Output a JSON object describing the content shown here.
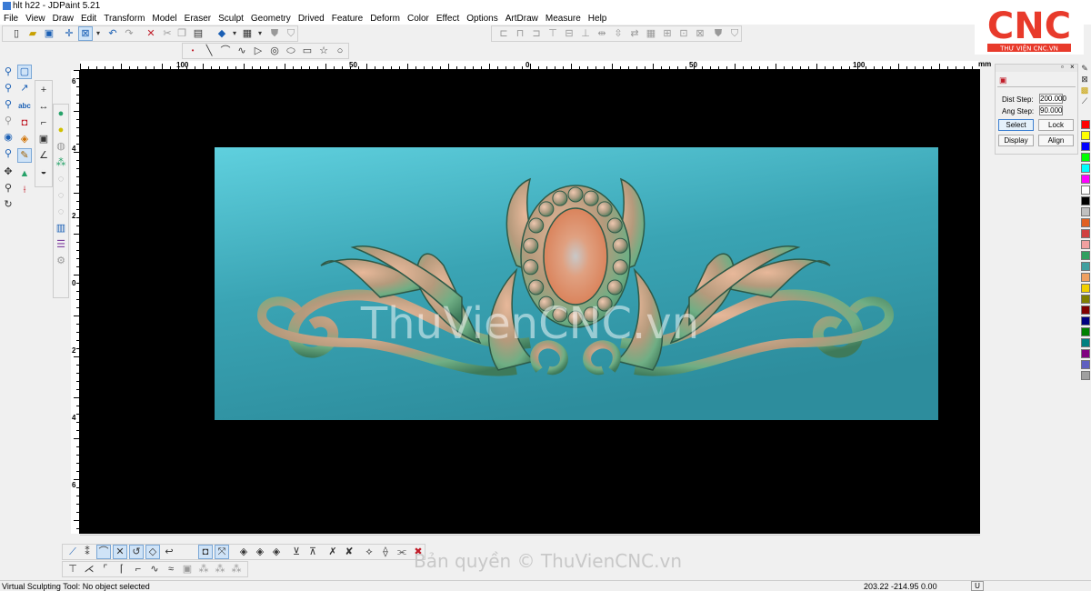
{
  "window": {
    "title": "hlt h22 - JDPaint 5.21"
  },
  "menu": [
    "File",
    "View",
    "Draw",
    "Edit",
    "Transform",
    "Model",
    "Eraser",
    "Sculpt",
    "Geometry",
    "Drived",
    "Feature",
    "Deform",
    "Color",
    "Effect",
    "Options",
    "ArtDraw",
    "Measure",
    "Help"
  ],
  "ruler": {
    "top_labels": [
      {
        "text": "100",
        "at": "left"
      },
      {
        "text": "50",
        "at": "left-mid"
      },
      {
        "text": "0",
        "at": "center"
      },
      {
        "text": "50",
        "at": "right-mid"
      },
      {
        "text": "100",
        "at": "right"
      }
    ],
    "unit": "mm",
    "left_labels": [
      "6",
      "4",
      "2",
      "0",
      "2",
      "4",
      "6"
    ]
  },
  "panel": {
    "dist_step_label": "Dist Step:",
    "dist_step_value": "200.000",
    "ang_step_label": "Ang Step:",
    "ang_step_value": "90.000",
    "buttons": [
      "Select",
      "Lock",
      "Display",
      "Align"
    ]
  },
  "palette": [
    "#ff0000",
    "#ffff00",
    "#0000ff",
    "#00ff00",
    "#00ffff",
    "#ff00ff",
    "#ffffff",
    "#000000",
    "#c0c0c0",
    "#e06020",
    "#d04040",
    "#f0a0a0",
    "#30a060",
    "#40a0a0",
    "#f0a060",
    "#f0d000",
    "#808000",
    "#800000",
    "#000080",
    "#008000",
    "#008080",
    "#800080",
    "#6060c0",
    "#a0a0a0"
  ],
  "canvas": {
    "watermark": "ThuVienCNC.vn"
  },
  "logo": {
    "letters": "CNC",
    "caption": "THƯ VIỆN CNC.VN"
  },
  "bottom_watermark": "Bản quyền © ThuVienCNC.vn",
  "status": {
    "message": "Virtual Sculpting Tool: No object selected",
    "coords": "203.22 -214.95 0.00",
    "unit_indicator": "U"
  },
  "colors": {
    "relief_bg": "#3aa3b3",
    "viewport_bg": "#000000",
    "accent": "#e83a2b"
  }
}
